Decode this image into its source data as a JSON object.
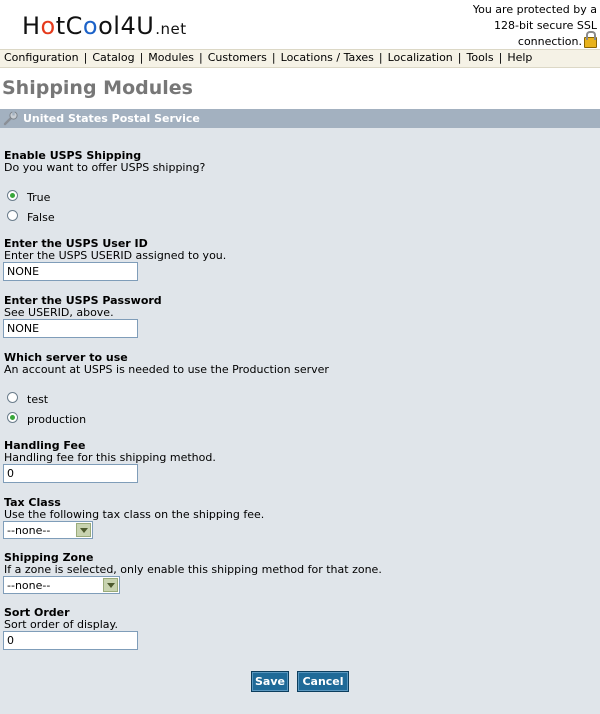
{
  "header": {
    "logo": {
      "part1": "H",
      "o1": "o",
      "part2": "tC",
      "o2": "o",
      "part3": "ol4U",
      "suffix": ".net"
    },
    "ssl_line1": "You are protected by a",
    "ssl_line2": "128-bit secure SSL",
    "ssl_line3": "connection."
  },
  "nav": {
    "items": [
      "Configuration",
      "Catalog",
      "Modules",
      "Customers",
      "Locations / Taxes",
      "Localization",
      "Tools",
      "Help"
    ],
    "separator": "|"
  },
  "page_title": "Shipping Modules",
  "panel": {
    "title": "United States Postal Service",
    "enable": {
      "label": "Enable USPS Shipping",
      "desc": "Do you want to offer USPS shipping?",
      "options": [
        "True",
        "False"
      ],
      "selected": "True"
    },
    "userid": {
      "label": "Enter the USPS User ID",
      "desc": "Enter the USPS USERID assigned to you.",
      "value": "NONE"
    },
    "password": {
      "label": "Enter the USPS Password",
      "desc": "See USERID, above.",
      "value": "NONE"
    },
    "server": {
      "label": "Which server to use",
      "desc": "An account at USPS is needed to use the Production server",
      "options": [
        "test",
        "production"
      ],
      "selected": "production"
    },
    "handling": {
      "label": "Handling Fee",
      "desc": "Handling fee for this shipping method.",
      "value": "0"
    },
    "tax_class": {
      "label": "Tax Class",
      "desc": "Use the following tax class on the shipping fee.",
      "value": "--none--"
    },
    "zone": {
      "label": "Shipping Zone",
      "desc": "If a zone is selected, only enable this shipping method for that zone.",
      "value": "--none--"
    },
    "sort": {
      "label": "Sort Order",
      "desc": "Sort order of display.",
      "value": "0"
    }
  },
  "buttons": {
    "save": "Save",
    "cancel": "Cancel"
  },
  "colors": {
    "panel_bg": "#e0e5ea",
    "panel_head": "#a3b1c0",
    "button": "#1f6a98",
    "radio_checked": "#39a73b"
  }
}
